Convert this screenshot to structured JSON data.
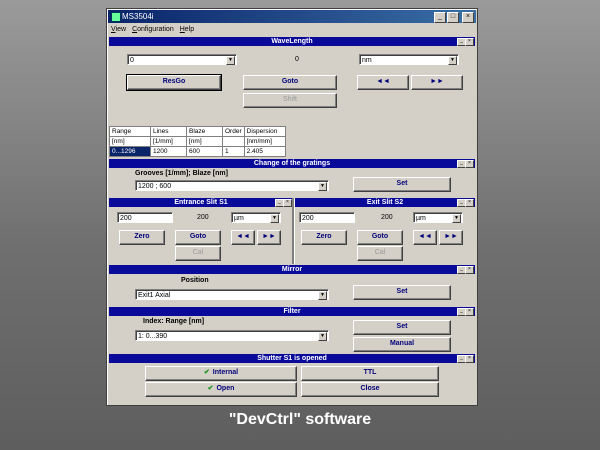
{
  "window": {
    "title": "MS3504i",
    "menu": [
      "View",
      "Configuration",
      "Help"
    ]
  },
  "wavelength": {
    "title": "WaveLength",
    "input_value": "0",
    "current_value": "0",
    "unit": "nm",
    "resgo_label": "ResGo",
    "goto_label": "Goto",
    "shift_label": "Shift",
    "rewind_label": "◄◄",
    "forward_label": "►►"
  },
  "grating_table": {
    "headers": [
      [
        "Range",
        "[nm]"
      ],
      [
        "Lines",
        "[1/mm]"
      ],
      [
        "Blaze",
        "[nm]"
      ],
      [
        "Order",
        ""
      ],
      [
        "Dispersion",
        "[nm/mm]"
      ]
    ],
    "row": [
      "0...1296",
      "1200",
      "600",
      "1",
      "2.405"
    ]
  },
  "gratings": {
    "title": "Change of the gratings",
    "label": "Grooves [1/mm]; Blaze [nm]",
    "selected": "1200     ; 600",
    "set_label": "Set"
  },
  "entrance_slit": {
    "title": "Entrance Slit S1",
    "input_value": "200",
    "current_value": "200",
    "unit": "µm",
    "zero_label": "Zero",
    "goto_label": "Goto",
    "cal_label": "Cal",
    "rewind_label": "◄◄",
    "forward_label": "►►"
  },
  "exit_slit": {
    "title": "Exit Slit S2",
    "input_value": "200",
    "current_value": "200",
    "unit": "µm",
    "zero_label": "Zero",
    "goto_label": "Goto",
    "cal_label": "Cal",
    "rewind_label": "◄◄",
    "forward_label": "►►"
  },
  "mirror": {
    "title": "Mirror",
    "label": "Position",
    "selected": "Exit1 Axial",
    "set_label": "Set"
  },
  "filter": {
    "title": "Filter",
    "label": "Index: Range [nm]",
    "selected": "1:   0...390",
    "set_label": "Set",
    "manual_label": "Manual"
  },
  "shutter": {
    "title": "Shutter S1 is opened",
    "internal_label": "Internal",
    "ttl_label": "TTL",
    "open_label": "Open",
    "close_label": "Close"
  },
  "caption": "\"DevCtrl\" software"
}
